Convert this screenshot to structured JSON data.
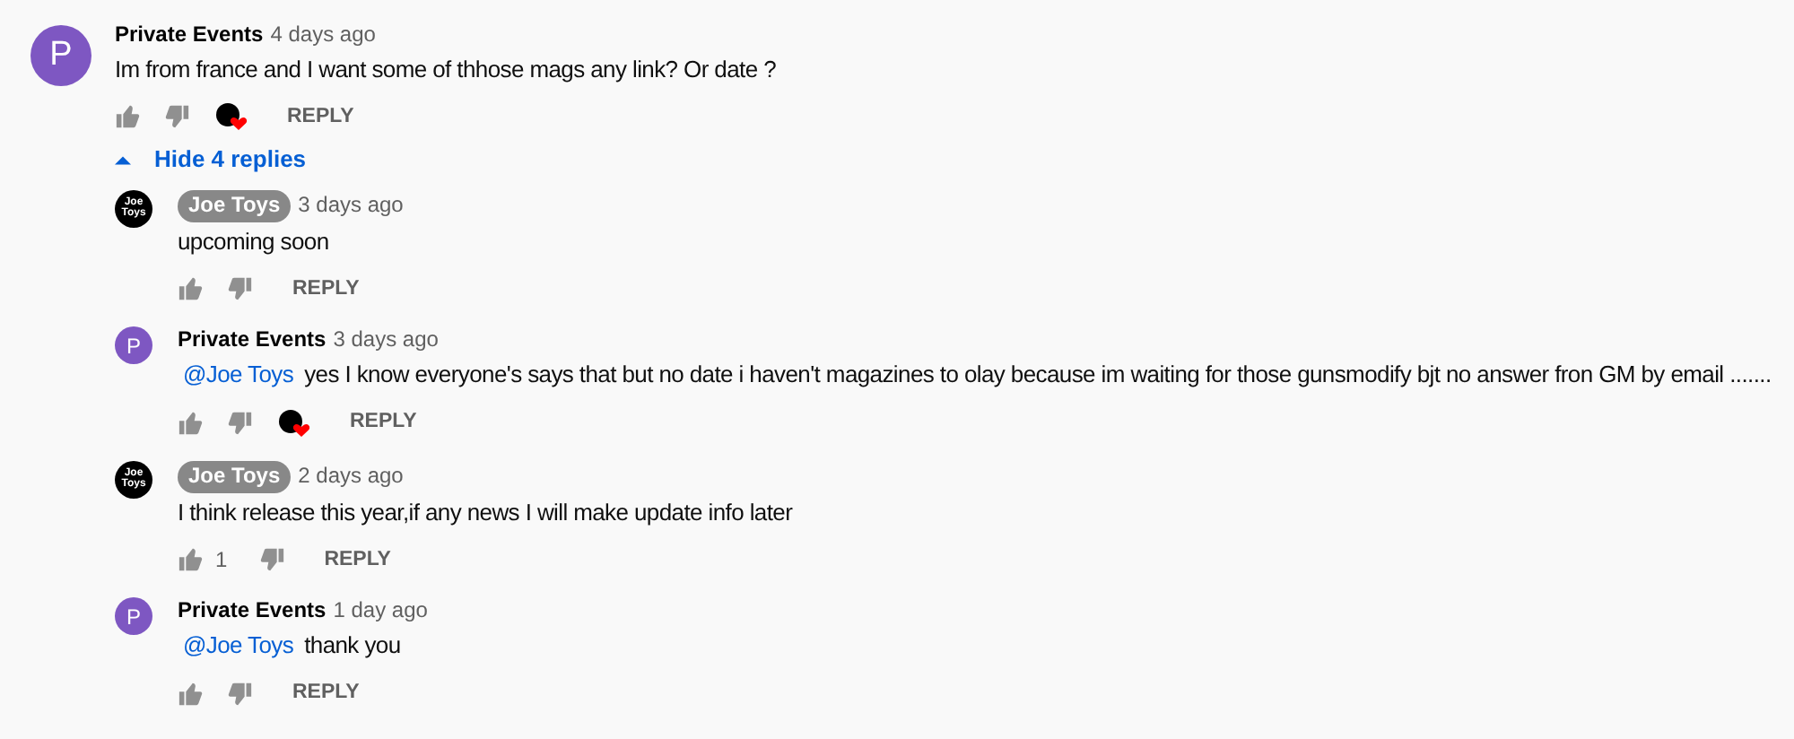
{
  "comment": {
    "author": "Private Events",
    "owner": false,
    "time": "4 days ago",
    "avatar": {
      "kind": "letter",
      "text": "P"
    },
    "text": "Im from france and I want some of thhose mags any link? Or date ?",
    "hearted": true,
    "reply_label": "REPLY"
  },
  "replies_toggle": {
    "label": "Hide 4 replies",
    "expanded": true
  },
  "replies": [
    {
      "author": "Joe Toys",
      "owner": true,
      "time": "3 days ago",
      "avatar": {
        "kind": "logo",
        "text": "Joe Toys"
      },
      "text": "upcoming soon",
      "hearted": false,
      "reply_label": "REPLY"
    },
    {
      "author": "Private Events",
      "owner": false,
      "time": "3 days ago",
      "avatar": {
        "kind": "letter",
        "text": "P"
      },
      "mention": "@Joe Toys",
      "text": "yes I know everyone's says that but no date i haven't magazines to olay because im waiting for those gunsmodify bjt no answer fron GM by email .......",
      "hearted": true,
      "reply_label": "REPLY"
    },
    {
      "author": "Joe Toys",
      "owner": true,
      "time": "2 days ago",
      "avatar": {
        "kind": "logo",
        "text": "Joe Toys"
      },
      "text": "I think release this year,if any news I will make update info later",
      "likes": "1",
      "hearted": false,
      "reply_label": "REPLY"
    },
    {
      "author": "Private Events",
      "owner": false,
      "time": "1 day ago",
      "avatar": {
        "kind": "letter",
        "text": "P"
      },
      "mention": "@Joe Toys",
      "text": "thank you",
      "hearted": false,
      "reply_label": "REPLY"
    }
  ]
}
